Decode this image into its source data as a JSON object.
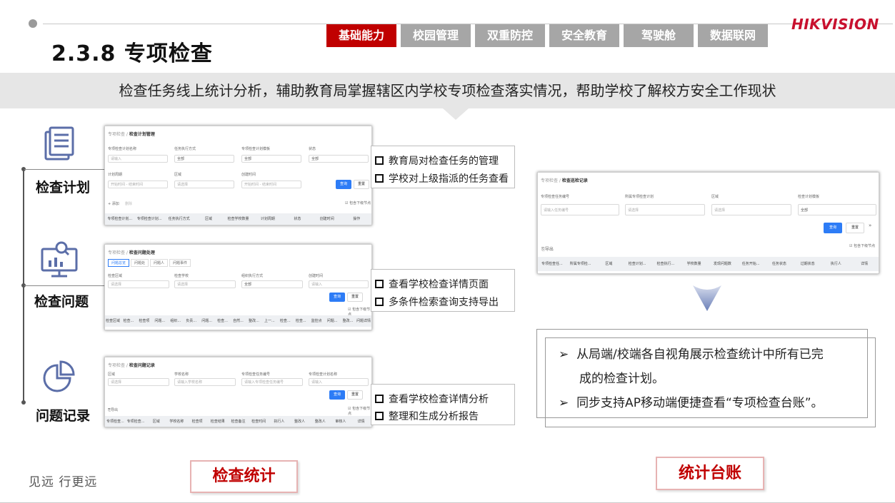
{
  "header": {
    "title": "2.3.8 专项检查",
    "logo": "HIKVISION",
    "nav": [
      "基础能力",
      "校园管理",
      "双重防控",
      "安全教育",
      "驾驶舱",
      "数据联网"
    ],
    "nav_active_index": 0,
    "subtitle": "检查任务线上统计分析，辅助教育局掌握辖区内学校专项检查落实情况，帮助学校了解校方安全工作现状"
  },
  "sections": [
    {
      "label": "检查计划",
      "icon": "document-list-icon"
    },
    {
      "label": "检查问题",
      "icon": "person-monitor-icon"
    },
    {
      "label": "问题记录",
      "icon": "pie-chart-icon"
    }
  ],
  "card1": {
    "bc_parent": "专项检查",
    "bc_current": "检查计划管理",
    "f1": "专项检查计划名称",
    "f1_ph": "请输入",
    "f2": "任务执行方式",
    "f2_val": "全部",
    "f3": "专项检查计划模板",
    "f3_val": "全部",
    "f4": "状态",
    "f4_val": "全部",
    "f5": "计划周期",
    "f5_start": "开始时间",
    "f5_end": "结束时间",
    "f6": "区域",
    "f6_ph": "请选择",
    "f7": "创建时间",
    "f7_start": "开始时间",
    "f7_end": "结束时间",
    "query": "查询",
    "reset": "重置",
    "add": "+ 添加",
    "del": "删除",
    "include_sub": "包含下级节点",
    "cols": [
      "专项检查计划...",
      "专项检查计划...",
      "任务执行方式",
      "区域",
      "检查学校数量",
      "计划周期",
      "状态",
      "创建时间",
      "操作"
    ]
  },
  "card2": {
    "bc_parent": "专项检查",
    "bc_current": "检查问题处理",
    "tabs": [
      "问题总览",
      "问题处",
      "问题人",
      "问题事件"
    ],
    "f1": "检查区域",
    "f1_ph": "请选择",
    "f2": "检查学校",
    "f2_ph": "请选择",
    "f3": "组织执行方式",
    "f3_val": "全部",
    "f4": "创建时间",
    "f4_ph": "请输入",
    "query": "查询",
    "reset": "重置",
    "include_sub": "包含下级节点",
    "cols": [
      "检查区域",
      "检查...",
      "检查项",
      "问题...",
      "组织...",
      "负责...",
      "问题...",
      "检查...",
      "自然...",
      "整改...",
      "上一...",
      "检查...",
      "检查...",
      "监控点",
      "问题...",
      "整改...",
      "问题详情"
    ]
  },
  "card3": {
    "bc_parent": "专项检查",
    "bc_current": "检查问题记录",
    "f1": "区域",
    "f1_ph": "请选择",
    "f2": "学校名称",
    "f2_ph": "请输入学校名称",
    "f3": "专项检查任务编号",
    "f3_ph": "请输入专项检查任务编号",
    "f4": "专项检查计划名称",
    "f4_ph": "请输入",
    "query": "查询",
    "reset": "重置",
    "export": "导出",
    "include_sub": "包含下级节点",
    "cols": [
      "专项检查...",
      "专项检查...",
      "区域",
      "学校名称",
      "检查项",
      "检查结果",
      "检查备注",
      "检查时间",
      "执行人",
      "整改人",
      "整改人",
      "审核人",
      "详情"
    ]
  },
  "card4": {
    "bc_parent": "专项检查",
    "bc_current": "检查巡检记录",
    "f1": "专项检查任务编号",
    "f1_ph": "请输入任务编号",
    "f2": "所属专项检查计划",
    "f2_ph": "请选择",
    "f3": "区域",
    "f3_ph": "请选择",
    "f4": "检查计划模板",
    "f4_val": "全部",
    "query": "查询",
    "reset": "重置",
    "export": "导出",
    "include_sub": "包含下级节点",
    "cols": [
      "专项检查任...",
      "所属专项检...",
      "区域",
      "检查计划...",
      "检查执行...",
      "学校数量",
      "发现问题数",
      "任务开始...",
      "任务状态",
      "过期状态",
      "执行人",
      "详情"
    ]
  },
  "bullets1": [
    "教育局对检查任务的管理",
    "学校对上级指派的任务查看"
  ],
  "bullets2": [
    "查看学校检查详情页面",
    "多条件检索查询支持导出"
  ],
  "bullets3": [
    "查看学校检查详情分析",
    "整理和生成分析报告"
  ],
  "right_box": {
    "line1a": "从局端/校端各自视角展示检查统计中所有已完",
    "line1b": "成的检查计划。",
    "line2": "同步支持AP移动端便捷查看“专项检查台账”。"
  },
  "buttons": {
    "left": "检查统计",
    "right": "统计台账"
  },
  "slogan": "见远 行更远",
  "colors": {
    "accent": "#c00000",
    "nav_inactive": "#a6a6a6",
    "band": "#e6e6e6",
    "query_blue": "#2d7cf6"
  }
}
